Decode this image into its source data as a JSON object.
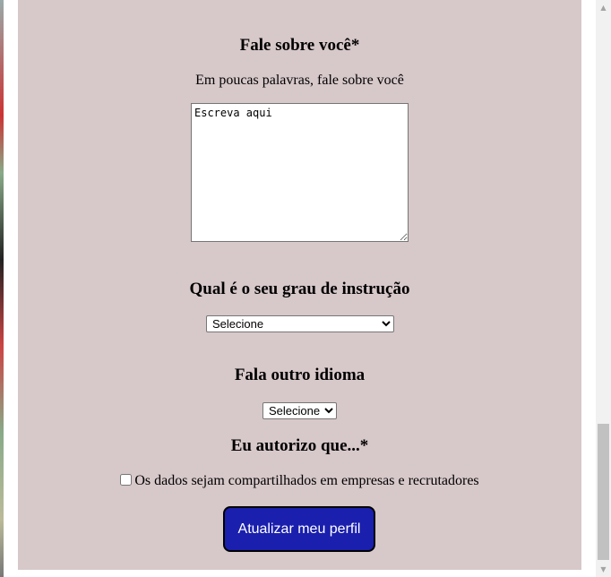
{
  "about": {
    "title": "Fale sobre você*",
    "subtitle": "Em poucas palavras, fale sobre você",
    "textarea_value": "Escreva aqui"
  },
  "education": {
    "title": "Qual é o seu grau de instrução",
    "selected": "Selecione"
  },
  "language": {
    "title": "Fala outro idioma",
    "selected": "Selecione"
  },
  "consent": {
    "title": "Eu autorizo que...*",
    "checkbox_label": "Os dados sejam compartilhados em empresas e recrutadores",
    "checked": false
  },
  "submit_label": "Atualizar meu perfil",
  "scrollbar": {
    "up_icon": "▲",
    "down_icon": "▼"
  },
  "colors": {
    "panel_bg": "#d7c8ca",
    "button_bg": "#1a1fad",
    "button_text": "#ffffff"
  }
}
